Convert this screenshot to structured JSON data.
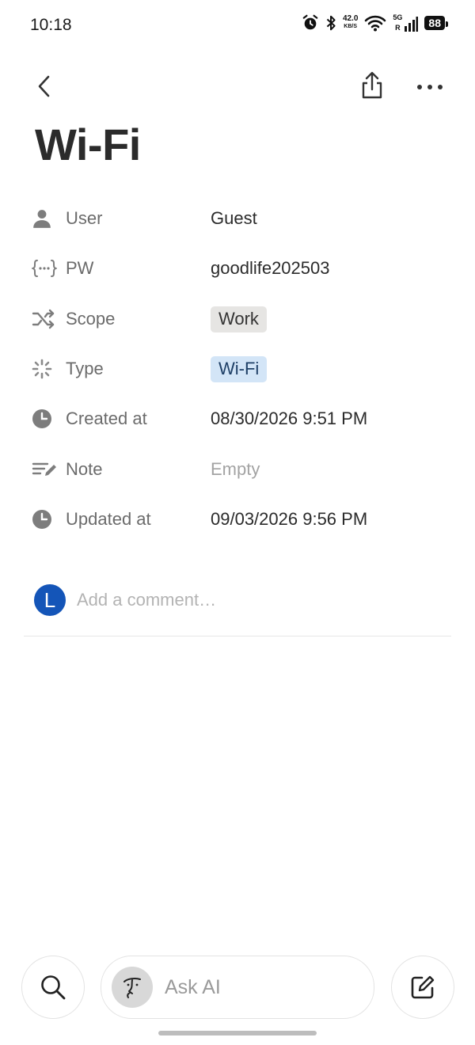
{
  "status_bar": {
    "time": "10:18",
    "net_speed_value": "42.0",
    "net_speed_unit": "KB/S",
    "network_type": "5G",
    "roaming": "R",
    "battery": "88",
    "icons": [
      "alarm-icon",
      "bluetooth-icon",
      "wifi-icon",
      "signal-icon",
      "battery-icon"
    ]
  },
  "header": {
    "back_icon": "chevron-left-icon",
    "share_icon": "share-icon",
    "more_icon": "more-horizontal-icon"
  },
  "page": {
    "title": "Wi-Fi"
  },
  "properties": [
    {
      "icon": "person-icon",
      "label": "User",
      "value": "Guest"
    },
    {
      "icon": "formula-braces-icon",
      "label": "PW",
      "value": "goodlife202503"
    },
    {
      "icon": "shuffle-icon",
      "label": "Scope",
      "value": "Work",
      "tag_color": "#e6e5e3"
    },
    {
      "icon": "loading-spinner-icon",
      "label": "Type",
      "value": "Wi-Fi",
      "tag_color": "#d3e5f7"
    },
    {
      "icon": "clock-icon",
      "label": "Created at",
      "value": "08/30/2026 9:51 PM"
    },
    {
      "icon": "note-lines-icon",
      "label": "Note",
      "value": "Empty"
    },
    {
      "icon": "clock-icon",
      "label": "Updated at",
      "value": "09/03/2026 9:56 PM"
    }
  ],
  "comment": {
    "avatar_letter": "L",
    "avatar_color": "#1455b8",
    "placeholder": "Add a comment…",
    "value": ""
  },
  "bottom_bar": {
    "search_icon": "search-icon",
    "ask_ai_label": "Ask AI",
    "ai_icon": "ai-face-icon",
    "compose_icon": "compose-icon"
  }
}
